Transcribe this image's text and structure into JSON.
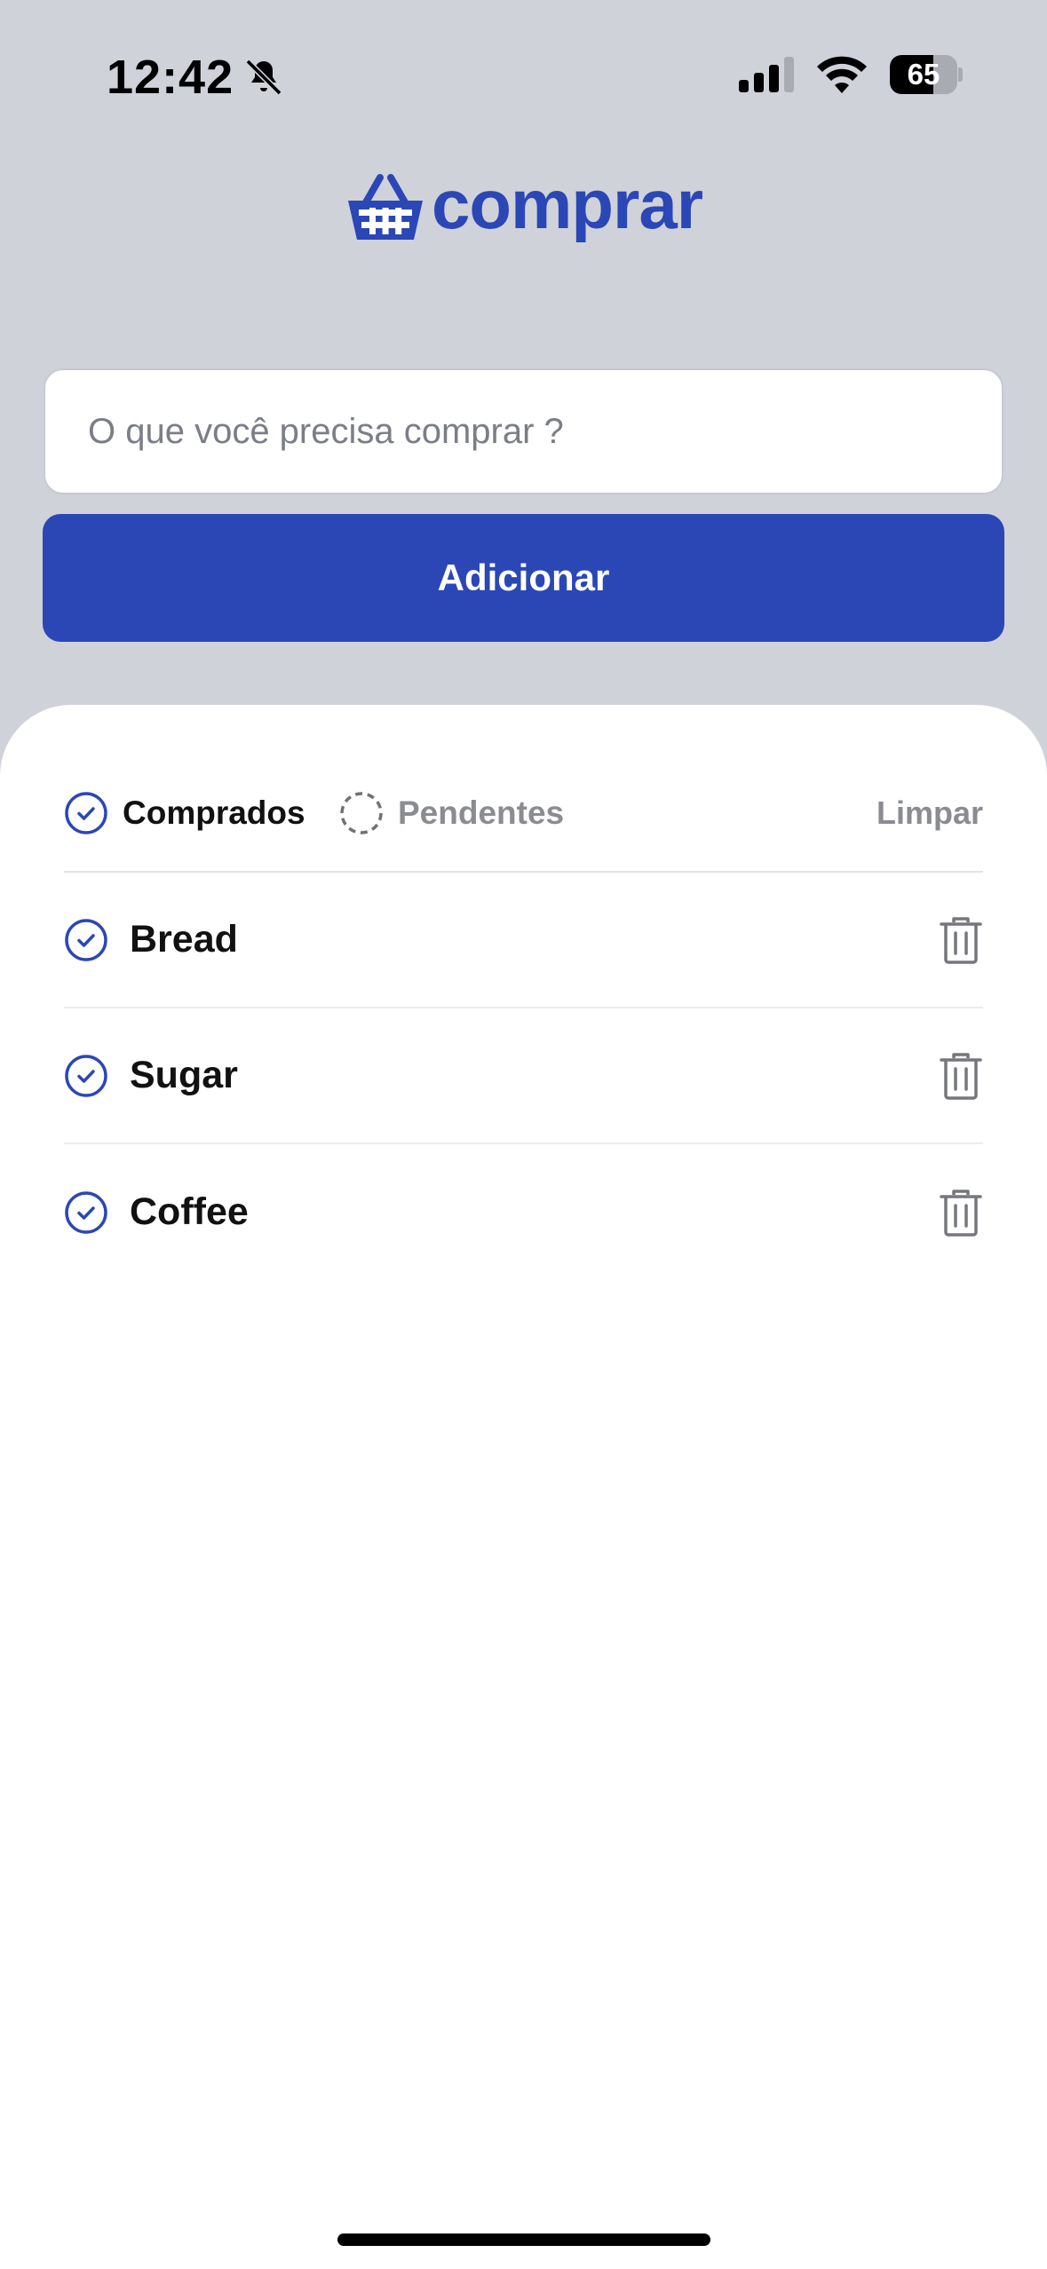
{
  "status_bar": {
    "time": "12:42",
    "battery_level": "65",
    "battery_fraction": 0.65,
    "icons": [
      "bell-slash-icon",
      "cellular-signal-icon",
      "wifi-icon",
      "battery-icon"
    ]
  },
  "logo": {
    "text": "comprar",
    "icon": "basket-icon",
    "color": "#2b47b5"
  },
  "form": {
    "placeholder": "O que você precisa comprar ?",
    "value": "",
    "add_label": "Adicionar"
  },
  "filters": {
    "bought_label": "Comprados",
    "pending_label": "Pendentes",
    "active": "bought",
    "clear_label": "Limpar"
  },
  "items": [
    {
      "name": "Bread",
      "status": "bought"
    },
    {
      "name": "Sugar",
      "status": "bought"
    },
    {
      "name": "Coffee",
      "status": "bought"
    }
  ],
  "colors": {
    "accent": "#2b47b5",
    "background": "#d0d2da",
    "muted": "#8a8c92"
  }
}
